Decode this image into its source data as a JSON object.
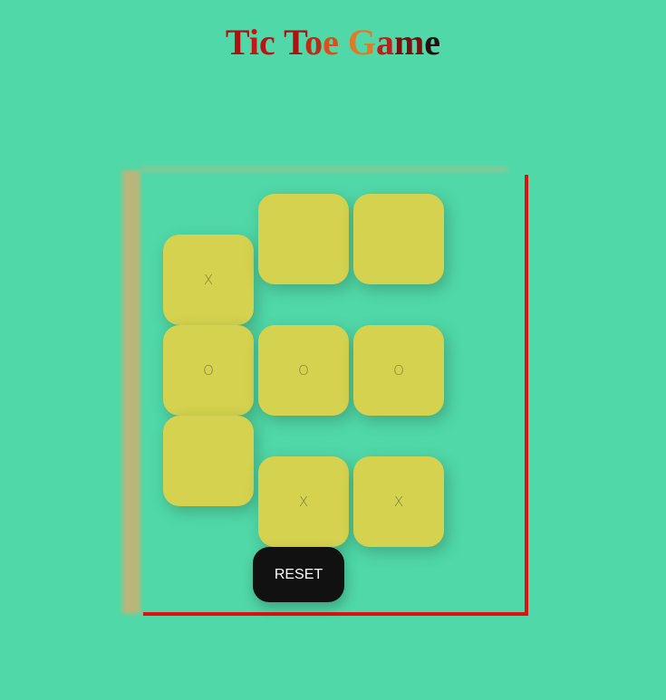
{
  "title": {
    "parts": [
      {
        "text": "T",
        "color": "#b01010"
      },
      {
        "text": "i",
        "color": "#c01818"
      },
      {
        "text": "c",
        "color": "#b81414"
      },
      {
        "text": " ",
        "color": "#b01010"
      },
      {
        "text": "T",
        "color": "#b01010"
      },
      {
        "text": "o",
        "color": "#c02a14"
      },
      {
        "text": "e",
        "color": "#d8501c"
      },
      {
        "text": " ",
        "color": "#b01010"
      },
      {
        "text": "G",
        "color": "#e07a2a"
      },
      {
        "text": "a",
        "color": "#c81818"
      },
      {
        "text": "m",
        "color": "#781010"
      },
      {
        "text": "e",
        "color": "#201010"
      }
    ]
  },
  "board": {
    "cells": [
      {
        "id": 1,
        "mark": "X"
      },
      {
        "id": 2,
        "mark": ""
      },
      {
        "id": 3,
        "mark": ""
      },
      {
        "id": 4,
        "mark": "O"
      },
      {
        "id": 5,
        "mark": "O"
      },
      {
        "id": 6,
        "mark": "O"
      },
      {
        "id": 7,
        "mark": ""
      },
      {
        "id": 8,
        "mark": "X"
      },
      {
        "id": 9,
        "mark": "X"
      }
    ]
  },
  "reset_label": "RESET",
  "colors": {
    "background": "#50d8a8",
    "cell": "#d4d24e",
    "frame": "#e01010",
    "reset_button": "#111111"
  }
}
